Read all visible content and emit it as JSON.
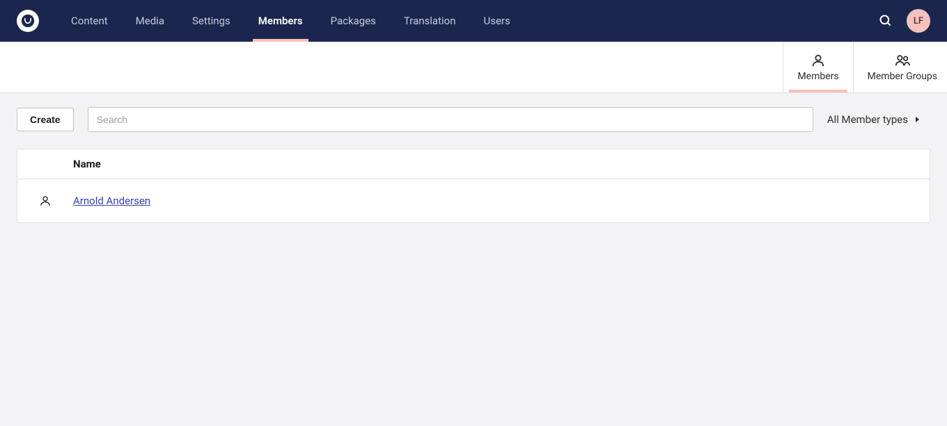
{
  "nav": {
    "items": [
      {
        "label": "Content"
      },
      {
        "label": "Media"
      },
      {
        "label": "Settings"
      },
      {
        "label": "Members"
      },
      {
        "label": "Packages"
      },
      {
        "label": "Translation"
      },
      {
        "label": "Users"
      }
    ]
  },
  "user": {
    "initials": "LF"
  },
  "subnav": {
    "members_label": "Members",
    "groups_label": "Member Groups"
  },
  "toolbar": {
    "create_label": "Create",
    "search_placeholder": "Search",
    "filter_label": "All Member types"
  },
  "table": {
    "header": {
      "name": "Name"
    },
    "rows": [
      {
        "name": "Arnold Andersen"
      }
    ]
  }
}
